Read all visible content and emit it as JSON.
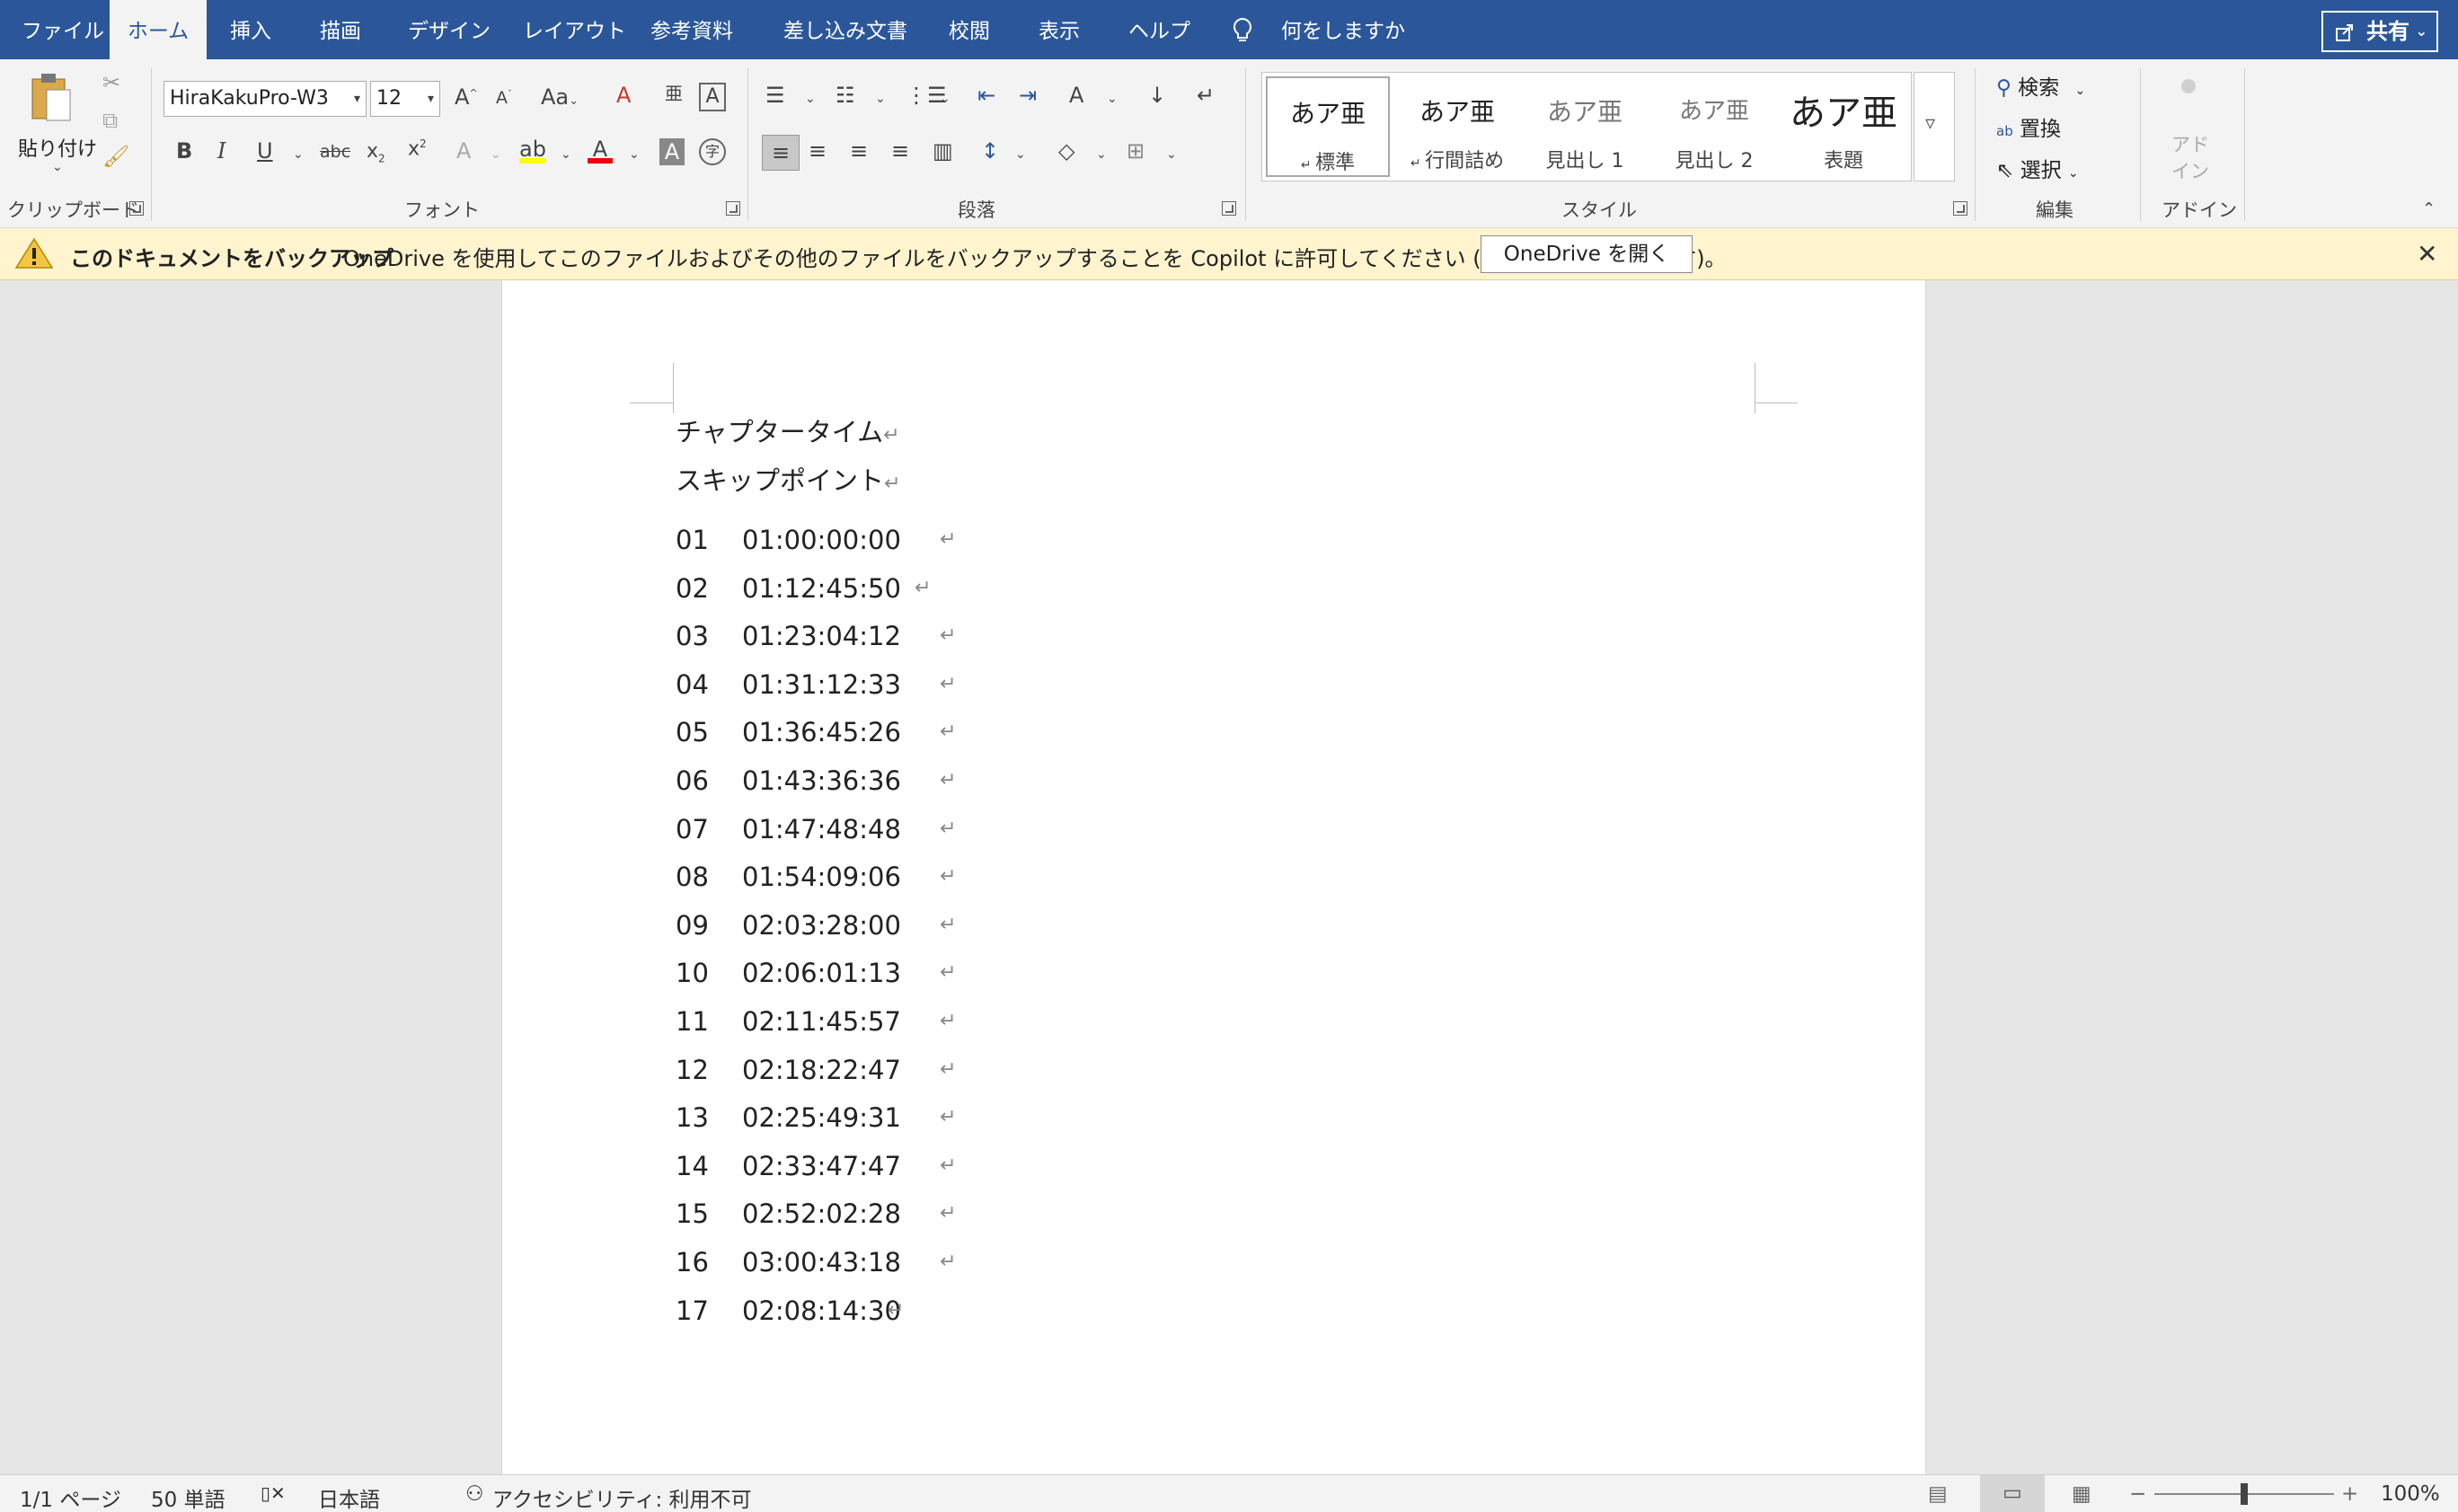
{
  "tabs": [
    {
      "label": "ファイル",
      "active": false
    },
    {
      "label": "ホーム",
      "active": true
    },
    {
      "label": "挿入",
      "active": false
    },
    {
      "label": "描画",
      "active": false
    },
    {
      "label": "デザイン",
      "active": false
    },
    {
      "label": "レイアウト",
      "active": false
    },
    {
      "label": "参考資料",
      "active": false
    },
    {
      "label": "差し込み文書",
      "active": false
    },
    {
      "label": "校閲",
      "active": false
    },
    {
      "label": "表示",
      "active": false
    },
    {
      "label": "ヘルプ",
      "active": false
    }
  ],
  "tell_me": "何をしますか",
  "share_label": "共有",
  "ribbon": {
    "clipboard": {
      "paste_label": "貼り付け",
      "group_label": "クリップボード"
    },
    "font": {
      "name": "HiraKakuPro-W3",
      "size": "12",
      "group_label": "フォント",
      "change_case_label": "Aa"
    },
    "paragraph": {
      "group_label": "段落"
    },
    "styles": {
      "group_label": "スタイル",
      "items": [
        {
          "sample": "あア亜",
          "name": "標準",
          "selected": true
        },
        {
          "sample": "あア亜",
          "name": "行間詰め",
          "selected": false
        },
        {
          "sample": "あア亜",
          "name": "見出し 1",
          "selected": false
        },
        {
          "sample": "あア亜",
          "name": "見出し 2",
          "selected": false
        },
        {
          "sample": "あア亜",
          "name": "表題",
          "selected": false
        }
      ]
    },
    "editing": {
      "group_label": "編集",
      "find_label": "検索",
      "replace_label": "置換",
      "select_label": "選択"
    },
    "addins": {
      "group_label": "アドイン",
      "button_label": "アド イン"
    }
  },
  "notification": {
    "title": "このドキュメントをバックアップ",
    "message": "OneDrive を使用してこのファイルおよびその他のファイルをバックアップすることを Copilot に許可してください (ライセンスが必要です)。",
    "button_label": "OneDrive を開く"
  },
  "document": {
    "heading1": "チャプタータイム",
    "heading2": "スキップポイント",
    "chapters": [
      {
        "num": "01",
        "time": "01:00:00:00"
      },
      {
        "num": "02",
        "time": "01:12:45:50"
      },
      {
        "num": "03",
        "time": "01:23:04:12"
      },
      {
        "num": "04",
        "time": "01:31:12:33"
      },
      {
        "num": "05",
        "time": "01:36:45:26"
      },
      {
        "num": "06",
        "time": "01:43:36:36"
      },
      {
        "num": "07",
        "time": "01:47:48:48"
      },
      {
        "num": "08",
        "time": "01:54:09:06"
      },
      {
        "num": "09",
        "time": "02:03:28:00"
      },
      {
        "num": "10",
        "time": "02:06:01:13"
      },
      {
        "num": "11",
        "time": "02:11:45:57"
      },
      {
        "num": "12",
        "time": "02:18:22:47"
      },
      {
        "num": "13",
        "time": "02:25:49:31"
      },
      {
        "num": "14",
        "time": "02:33:47:47"
      },
      {
        "num": "15",
        "time": "02:52:02:28"
      },
      {
        "num": "16",
        "time": "03:00:43:18"
      },
      {
        "num": "17",
        "time": "02:08:14:30"
      }
    ],
    "paragraph_mark": "↵"
  },
  "status": {
    "page": "1/1 ページ",
    "words": "50 単語",
    "language": "日本語",
    "accessibility": "アクセシビリティ: 利用不可",
    "zoom": "100%",
    "zoom_level": 1.0
  }
}
